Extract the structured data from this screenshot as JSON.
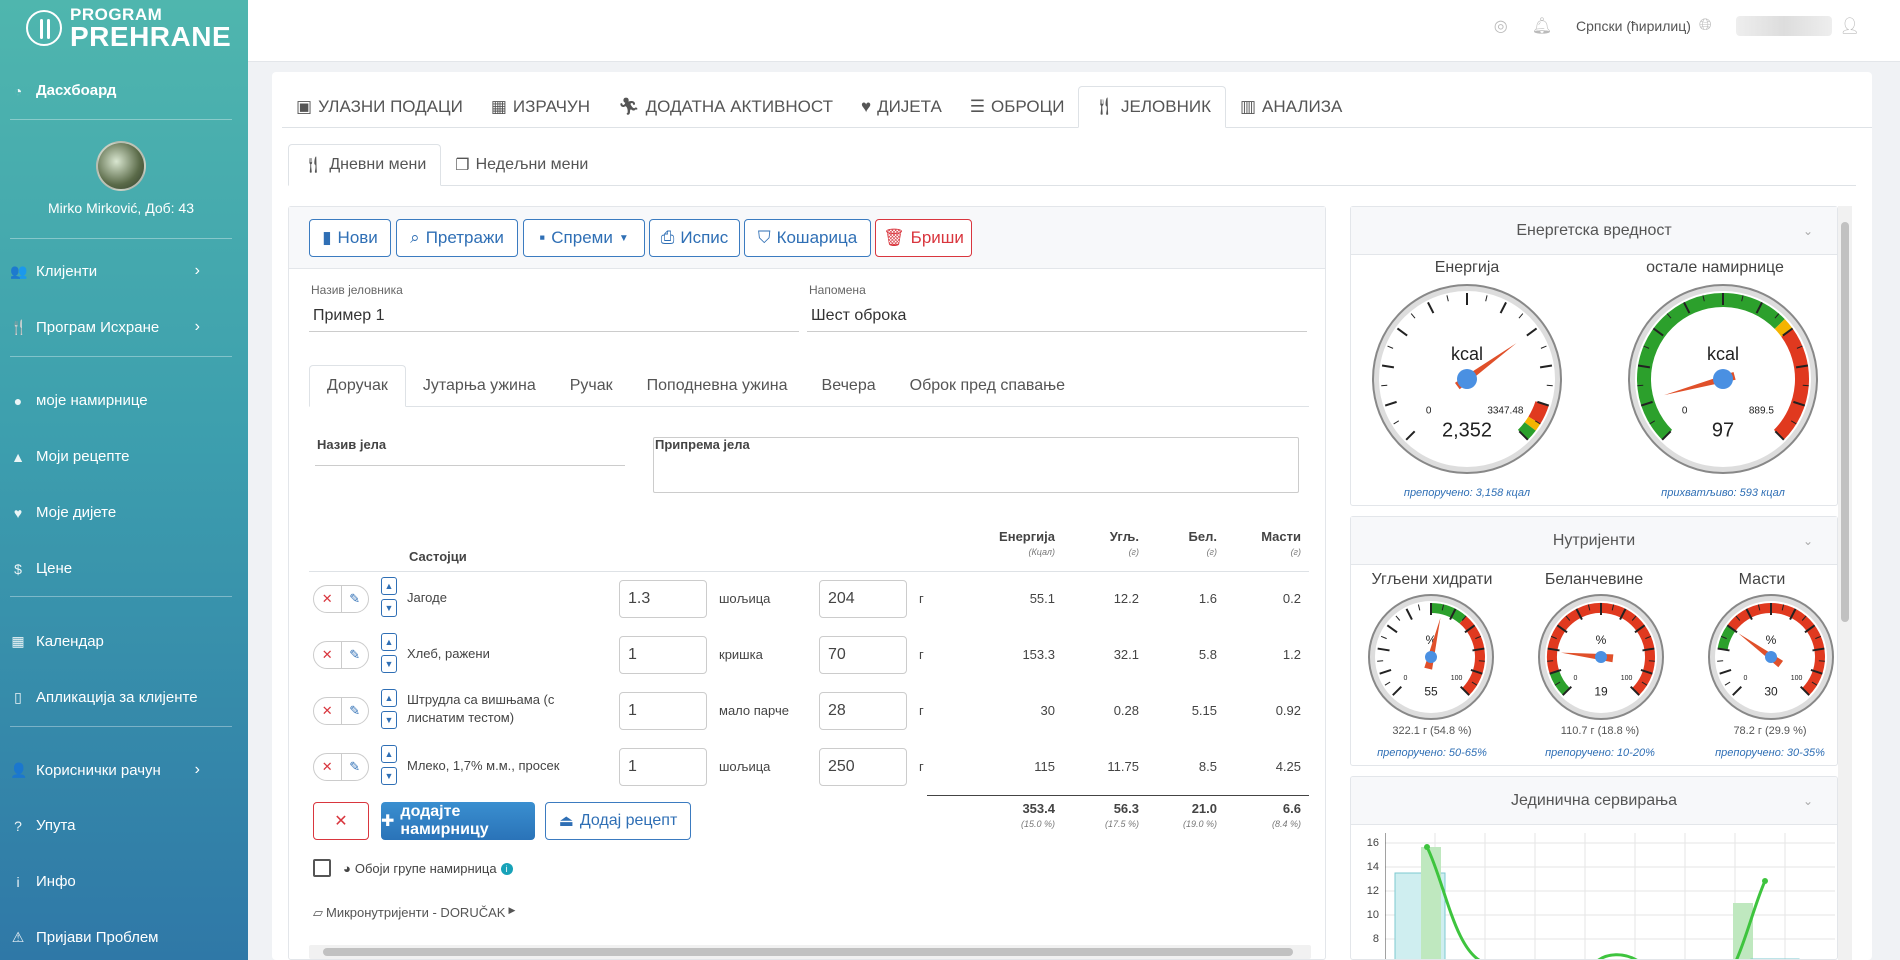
{
  "brand": {
    "line1": "PROGRAM",
    "line2": "PREHRANE"
  },
  "sidebar": {
    "dashboard": "Дасхбоард",
    "user": "Mirko Mirković, Доб: 43",
    "items": [
      {
        "label": "Клијенти",
        "icon": "users-icon"
      },
      {
        "label": "Програм Исхране",
        "icon": "utensils-icon"
      },
      {
        "label": "моје намирнице",
        "icon": "apple-icon"
      },
      {
        "label": "Моји рецепте",
        "icon": "cloche-icon"
      },
      {
        "label": "Моје дијете",
        "icon": "heart-icon"
      },
      {
        "label": "Цене",
        "icon": "dollar-icon"
      },
      {
        "label": "Календар",
        "icon": "calendar-icon"
      },
      {
        "label": "Апликација за клијенте",
        "icon": "mobile-icon"
      },
      {
        "label": "Кориснички рачун",
        "icon": "user-cog-icon"
      },
      {
        "label": "Упута",
        "icon": "question-icon"
      },
      {
        "label": "Инфо",
        "icon": "info-icon"
      },
      {
        "label": "Пријави Проблем",
        "icon": "warning-icon"
      }
    ]
  },
  "topbar": {
    "language": "Српски (ћирилиц)"
  },
  "tabs": [
    "УЛАЗНИ ПОДАЦИ",
    "ИЗРАЧУН",
    "ДОДАТНА АКТИВНОСТ",
    "ДИЈЕТА",
    "ОБРОЦИ",
    "ЈЕЛОВНИК",
    "АНАЛИЗА"
  ],
  "subtabs": [
    "Дневни мени",
    "Недељни мени"
  ],
  "toolbar": {
    "new": "Нови",
    "search": "Претражи",
    "save": "Спреми",
    "print": "Испис",
    "cart": "Кошарица",
    "delete": "Бриши"
  },
  "form": {
    "name_label": "Назив јеловника",
    "name_value": "Пример 1",
    "note_label": "Напомена",
    "note_value": "Шест оброка"
  },
  "meals": [
    "Доручак",
    "Јутарња ужина",
    "Ручак",
    "Поподневна ужина",
    "Вечера",
    "Оброк пред спавање"
  ],
  "dish": {
    "name_label": "Назив јела",
    "prep_label": "Припрема јела"
  },
  "table": {
    "ingredients_header": "Састојци",
    "headers": [
      {
        "label": "Енергија",
        "unit": "(Кцал)"
      },
      {
        "label": "Угљ.",
        "unit": "(г)"
      },
      {
        "label": "Бел.",
        "unit": "(г)"
      },
      {
        "label": "Масти",
        "unit": "(г)"
      }
    ],
    "rows": [
      {
        "name": "Јагоде",
        "qty": "1.3",
        "unit": "шољица",
        "grams": "204",
        "g": "г",
        "energy": "55.1",
        "carbs": "12.2",
        "protein": "1.6",
        "fat": "0.2"
      },
      {
        "name": "Хлеб, ражени",
        "qty": "1",
        "unit": "кришка",
        "grams": "70",
        "g": "г",
        "energy": "153.3",
        "carbs": "32.1",
        "protein": "5.8",
        "fat": "1.2"
      },
      {
        "name": "Штрудла са вишњама (с лиснатим тестом)",
        "qty": "1",
        "unit": "мало парче",
        "grams": "28",
        "g": "г",
        "energy": "30",
        "carbs": "0.28",
        "protein": "5.15",
        "fat": "0.92"
      },
      {
        "name": "Млеко, 1,7% м.м., просек",
        "qty": "1",
        "unit": "шољица",
        "grams": "250",
        "g": "г",
        "energy": "115",
        "carbs": "11.75",
        "protein": "8.5",
        "fat": "4.25"
      }
    ],
    "totals": [
      {
        "value": "353.4",
        "pct": "(15.0 %)"
      },
      {
        "value": "56.3",
        "pct": "(17.5 %)"
      },
      {
        "value": "21.0",
        "pct": "(19.0 %)"
      },
      {
        "value": "6.6",
        "pct": "(8.4 %)"
      }
    ]
  },
  "actions": {
    "remove": "✕",
    "add_food": "додајте намирницу",
    "add_recipe": "Додај рецепт",
    "color_groups": "Обоји групе намирница",
    "micro": "Микронутријенти - DORUČAK"
  },
  "energy_panel": {
    "title": "Енергетска вредност",
    "gauges": [
      {
        "title": "Енергија",
        "unit": "kcal",
        "value": "2,352",
        "min": "0",
        "max": "3347.48",
        "note": "препоручено: 3,158 кцал",
        "needle": 0.7
      },
      {
        "title": "остале намирнице",
        "unit": "kcal",
        "value": "97",
        "min": "0",
        "max": "889.5",
        "note": "прихватљиво: 593 кцал",
        "needle": 0.11
      }
    ]
  },
  "nutrients_panel": {
    "title": "Нутријенти",
    "gauges": [
      {
        "title": "Угљени хидрати",
        "unit": "%",
        "value": "55",
        "min": "0",
        "max": "100",
        "detail": "322.1 г (54.8 %)",
        "note": "препоручено: 50-65%",
        "needle": 0.55
      },
      {
        "title": "Беланчевине",
        "unit": "%",
        "value": "19",
        "min": "0",
        "max": "100",
        "detail": "110.7 г (18.8 %)",
        "note": "препоручено: 10-20%",
        "needle": 0.19
      },
      {
        "title": "Масти",
        "unit": "%",
        "value": "30",
        "min": "0",
        "max": "100",
        "detail": "78.2 г (29.9 %)",
        "note": "препоручено: 30-35%",
        "needle": 0.3
      }
    ]
  },
  "servings_panel": {
    "title": "Јединична сервирања",
    "yticks": [
      "16",
      "14",
      "12",
      "10",
      "8"
    ]
  },
  "colors": {
    "accent": "#2f6fb5",
    "danger": "#d9363e",
    "green": "#2ca02c",
    "red": "#e0391f",
    "sidebar_top": "#4fb6ae",
    "sidebar_bottom": "#2f78a7"
  }
}
